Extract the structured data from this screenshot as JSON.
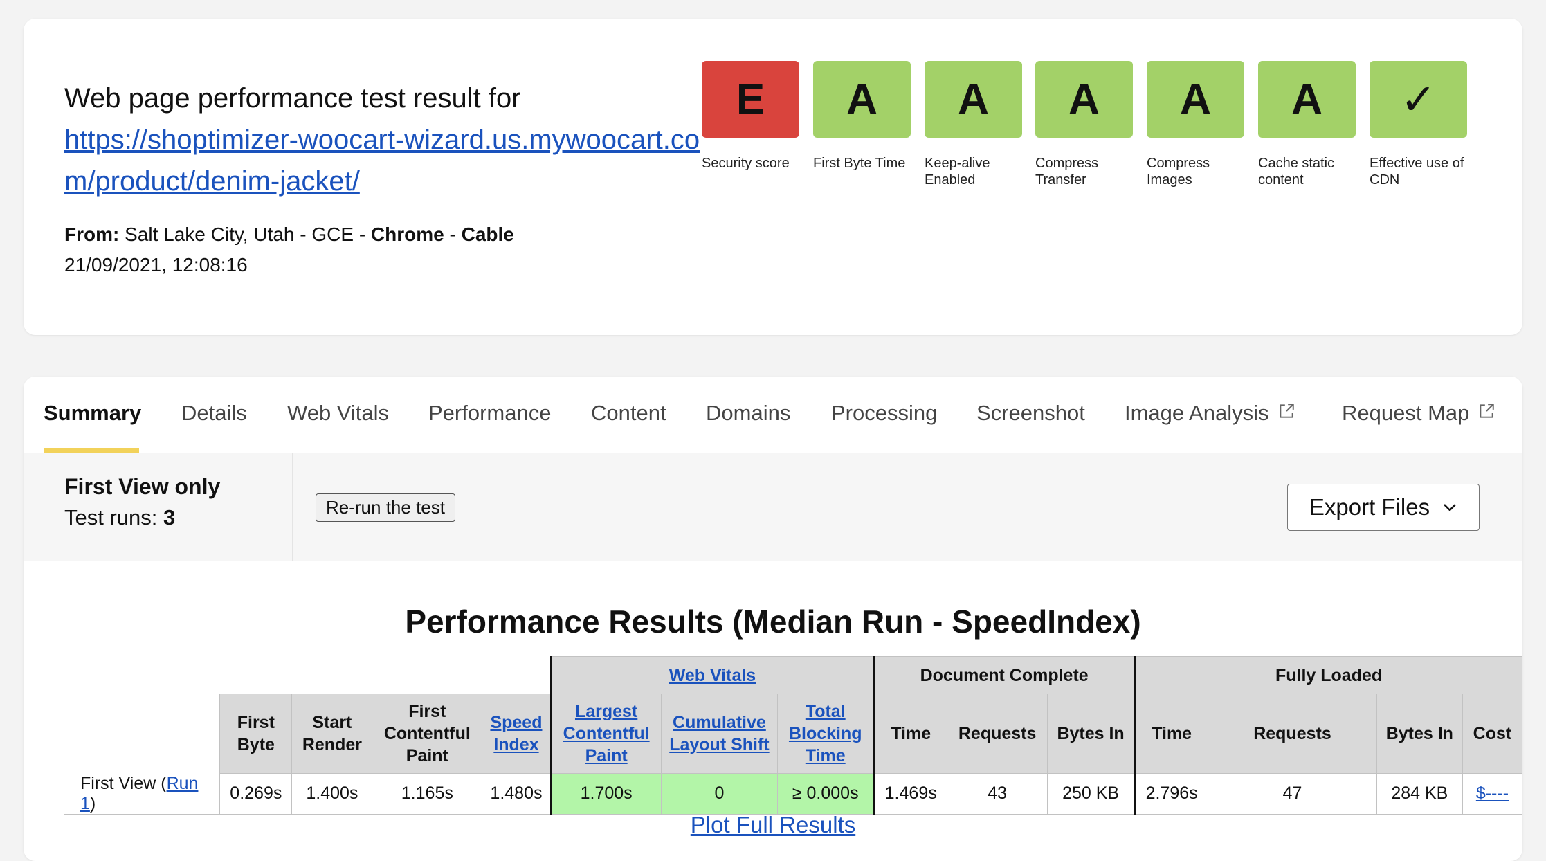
{
  "header": {
    "title": "Web page performance test result for",
    "url": "https://shoptimizer-woocart-wizard.us.mywoocart.com/product/denim-jacket/",
    "from_label": "From:",
    "location": "Salt Lake City, Utah - GCE -",
    "browser": "Chrome",
    "separator": "-",
    "connection": "Cable",
    "date": "21/09/2021, 12:08:16"
  },
  "grades": [
    {
      "grade": "E",
      "label": "Security score",
      "color": "#d9443d"
    },
    {
      "grade": "A",
      "label": "First Byte Time",
      "color": "#a3d168"
    },
    {
      "grade": "A",
      "label": "Keep-alive Enabled",
      "color": "#a3d168"
    },
    {
      "grade": "A",
      "label": "Compress Transfer",
      "color": "#a3d168"
    },
    {
      "grade": "A",
      "label": "Compress Images",
      "color": "#a3d168"
    },
    {
      "grade": "A",
      "label": "Cache static content",
      "color": "#a3d168"
    },
    {
      "grade": "✓",
      "label": "Effective use of CDN",
      "color": "#a3d168"
    }
  ],
  "tabs": [
    {
      "label": "Summary",
      "active": true
    },
    {
      "label": "Details"
    },
    {
      "label": "Web Vitals"
    },
    {
      "label": "Performance"
    },
    {
      "label": "Content"
    },
    {
      "label": "Domains"
    },
    {
      "label": "Processing"
    },
    {
      "label": "Screenshot"
    },
    {
      "label": "Image Analysis",
      "external": true
    },
    {
      "label": "Request Map",
      "external": true
    }
  ],
  "runbar": {
    "view_mode": "First View only",
    "test_runs_label": "Test runs:",
    "test_runs_value": "3",
    "rerun_label": "Re-run the test",
    "export_label": "Export Files"
  },
  "results": {
    "title": "Performance Results (Median Run - SpeedIndex)",
    "group_headers": {
      "web_vitals": "Web Vitals",
      "document_complete": "Document Complete",
      "fully_loaded": "Fully Loaded"
    },
    "columns": {
      "first_byte": "First Byte",
      "start_render": "Start Render",
      "fcp": "First Contentful Paint",
      "speed_index": "Speed Index",
      "lcp": "Largest Contentful Paint",
      "cls": "Cumulative Layout Shift",
      "tbt": "Total Blocking Time",
      "dc_time": "Time",
      "dc_requests": "Requests",
      "dc_bytes": "Bytes In",
      "fl_time": "Time",
      "fl_requests": "Requests",
      "fl_bytes": "Bytes In",
      "cost": "Cost"
    },
    "row": {
      "label_prefix": "First View (",
      "run_link": "Run 1",
      "label_suffix": ")",
      "first_byte": "0.269s",
      "start_render": "1.400s",
      "fcp": "1.165s",
      "speed_index": "1.480s",
      "lcp": "1.700s",
      "cls": "0",
      "tbt": "≥ 0.000s",
      "dc_time": "1.469s",
      "dc_requests": "43",
      "dc_bytes": "250 KB",
      "fl_time": "2.796s",
      "fl_requests": "47",
      "fl_bytes": "284 KB",
      "cost": "$----"
    },
    "plot_link": "Plot Full Results"
  }
}
